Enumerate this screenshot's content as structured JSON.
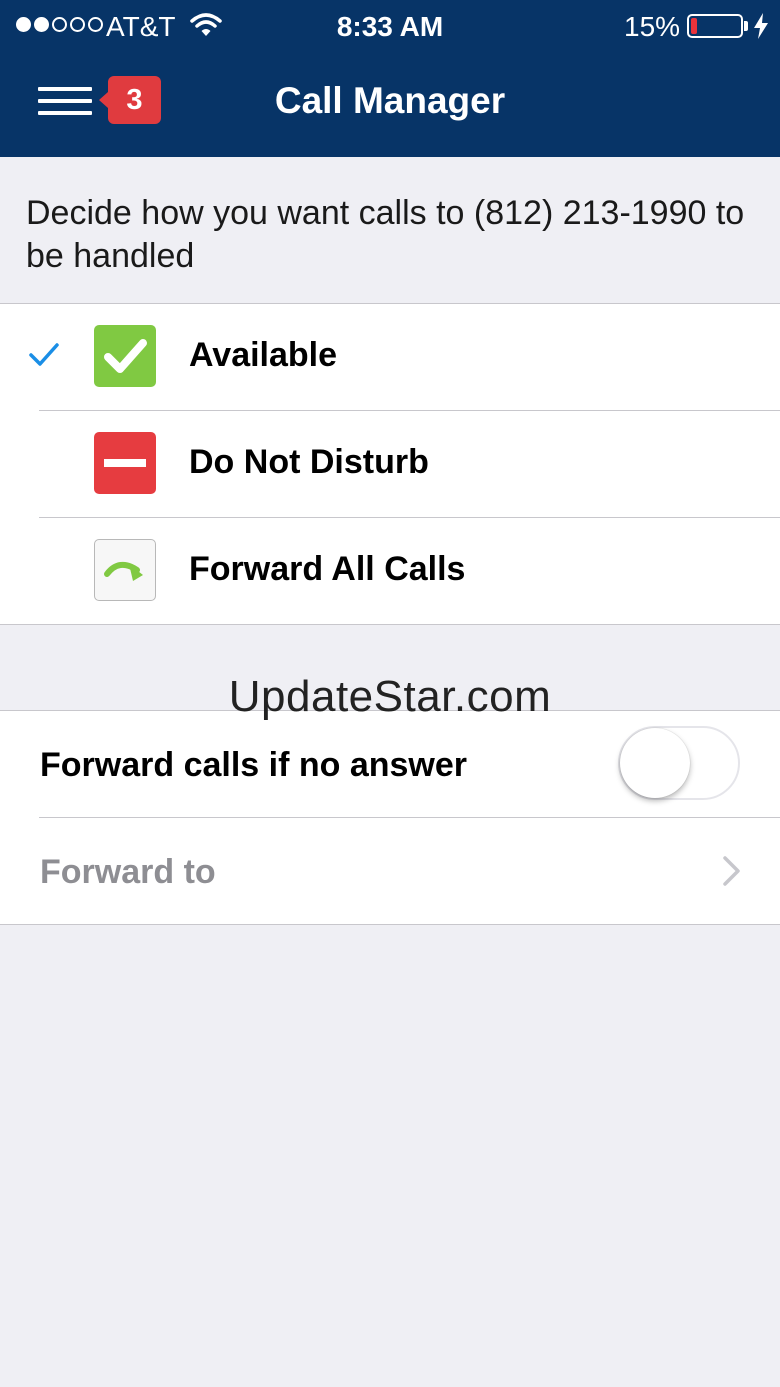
{
  "status_bar": {
    "carrier": "AT&T",
    "time": "8:33 AM",
    "battery_percent": "15%",
    "signal_bars_filled": 2,
    "signal_bars_total": 5,
    "battery_level": 0.15,
    "battery_color": "#e8333b"
  },
  "nav": {
    "title": "Call Manager",
    "badge_count": "3",
    "menu_icon": "hamburger-menu-icon",
    "header_color": "#073467",
    "badge_color": "#e03b3f"
  },
  "description": "Decide how you want calls to (812) 213-1990 to be handled",
  "call_status": {
    "selected": "Available",
    "options": [
      {
        "label": "Available",
        "icon": "available-check-icon",
        "color": "#80c942",
        "selected": true
      },
      {
        "label": "Do Not Disturb",
        "icon": "do-not-disturb-icon",
        "color": "#e63c40",
        "selected": false
      },
      {
        "label": "Forward All Calls",
        "icon": "forward-arrow-icon",
        "color": "#80c942",
        "selected": false
      }
    ]
  },
  "watermark": "UpdateStar.com",
  "forwarding": {
    "no_answer_label": "Forward calls if no answer",
    "no_answer_enabled": false,
    "forward_to_label": "Forward to"
  }
}
